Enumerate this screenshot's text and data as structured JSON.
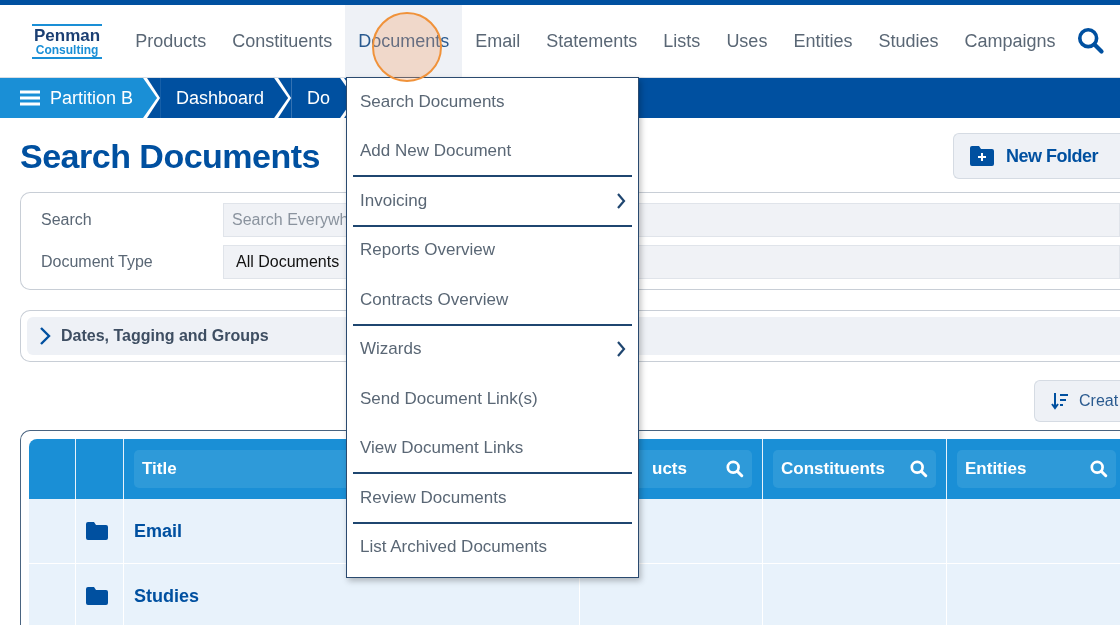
{
  "logo": {
    "line_1": "Penman",
    "line_2": "Consulting"
  },
  "nav": [
    {
      "label": "Products",
      "selected": false
    },
    {
      "label": "Constituents",
      "selected": false
    },
    {
      "label": "Documents",
      "selected": true
    },
    {
      "label": "Email",
      "selected": false
    },
    {
      "label": "Statements",
      "selected": false
    },
    {
      "label": "Lists",
      "selected": false
    },
    {
      "label": "Uses",
      "selected": false
    },
    {
      "label": "Entities",
      "selected": false
    },
    {
      "label": "Studies",
      "selected": false
    },
    {
      "label": "Campaigns",
      "selected": false
    }
  ],
  "breadcrumbs": [
    "Partition B",
    "Dashboard",
    "Do"
  ],
  "page_title": "Search Documents",
  "new_folder_button": "New Folder",
  "filters": [
    {
      "label": "Search",
      "kind": "text",
      "placeholder": "Search Everywh"
    },
    {
      "label": "Document Type",
      "kind": "select",
      "value": "All Documents"
    }
  ],
  "collapsible": {
    "label": "Dates, Tagging and Groups",
    "expanded": false
  },
  "sort_button": "Creat",
  "table": {
    "columns": [
      {
        "label": "Title"
      },
      {
        "label": "ucts",
        "searchable": true
      },
      {
        "label": "Constituents",
        "searchable": true
      },
      {
        "label": "Entities",
        "searchable": true
      }
    ],
    "rows": [
      {
        "title": "Email"
      },
      {
        "title": "Studies"
      }
    ]
  },
  "menu": [
    {
      "label": "Search Documents",
      "submenu": false,
      "divider_after": false
    },
    {
      "label": "Add New Document",
      "submenu": false,
      "divider_after": true
    },
    {
      "label": "Invoicing",
      "submenu": true,
      "divider_after": true
    },
    {
      "label": "Reports Overview",
      "submenu": false,
      "divider_after": false
    },
    {
      "label": "Contracts Overview",
      "submenu": false,
      "divider_after": true
    },
    {
      "label": "Wizards",
      "submenu": true,
      "divider_after": false
    },
    {
      "label": "Send Document Link(s)",
      "submenu": false,
      "divider_after": false
    },
    {
      "label": "View Document Links",
      "submenu": false,
      "divider_after": true
    },
    {
      "label": "Review Documents",
      "submenu": false,
      "divider_after": true
    },
    {
      "label": "List Archived Documents",
      "submenu": false,
      "divider_after": false
    }
  ]
}
